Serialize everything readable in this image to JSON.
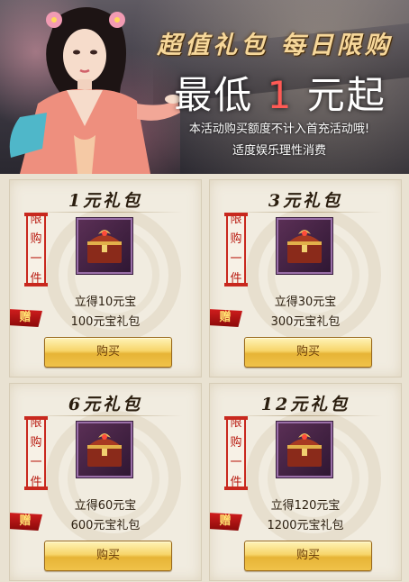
{
  "banner": {
    "title": "超值礼包  每日限购",
    "headline_prefix": "最低 ",
    "headline_number": "1",
    "headline_suffix": " 元起",
    "note": "本活动购买额度不计入首充活动哦!",
    "note2": "适度娱乐理性消费"
  },
  "limit_tag": [
    "限",
    "购",
    "一",
    "件"
  ],
  "gift_badge": "赠",
  "packages": [
    {
      "title": "1元礼包",
      "line1": "立得10元宝",
      "line2": "100元宝礼包",
      "button": "购买"
    },
    {
      "title": "3元礼包",
      "line1": "立得30元宝",
      "line2": "300元宝礼包",
      "button": "购买"
    },
    {
      "title": "6元礼包",
      "line1": "立得60元宝",
      "line2": "600元宝礼包",
      "button": "购买"
    },
    {
      "title": "12元礼包",
      "line1": "立得120元宝",
      "line2": "1200元宝礼包",
      "button": "购买"
    }
  ],
  "icons": {
    "item": "treasure-chest-icon"
  },
  "colors": {
    "accent_red": "#c8281e",
    "title_gold": "#f6d79a",
    "button_gold": "#f7d56a"
  }
}
